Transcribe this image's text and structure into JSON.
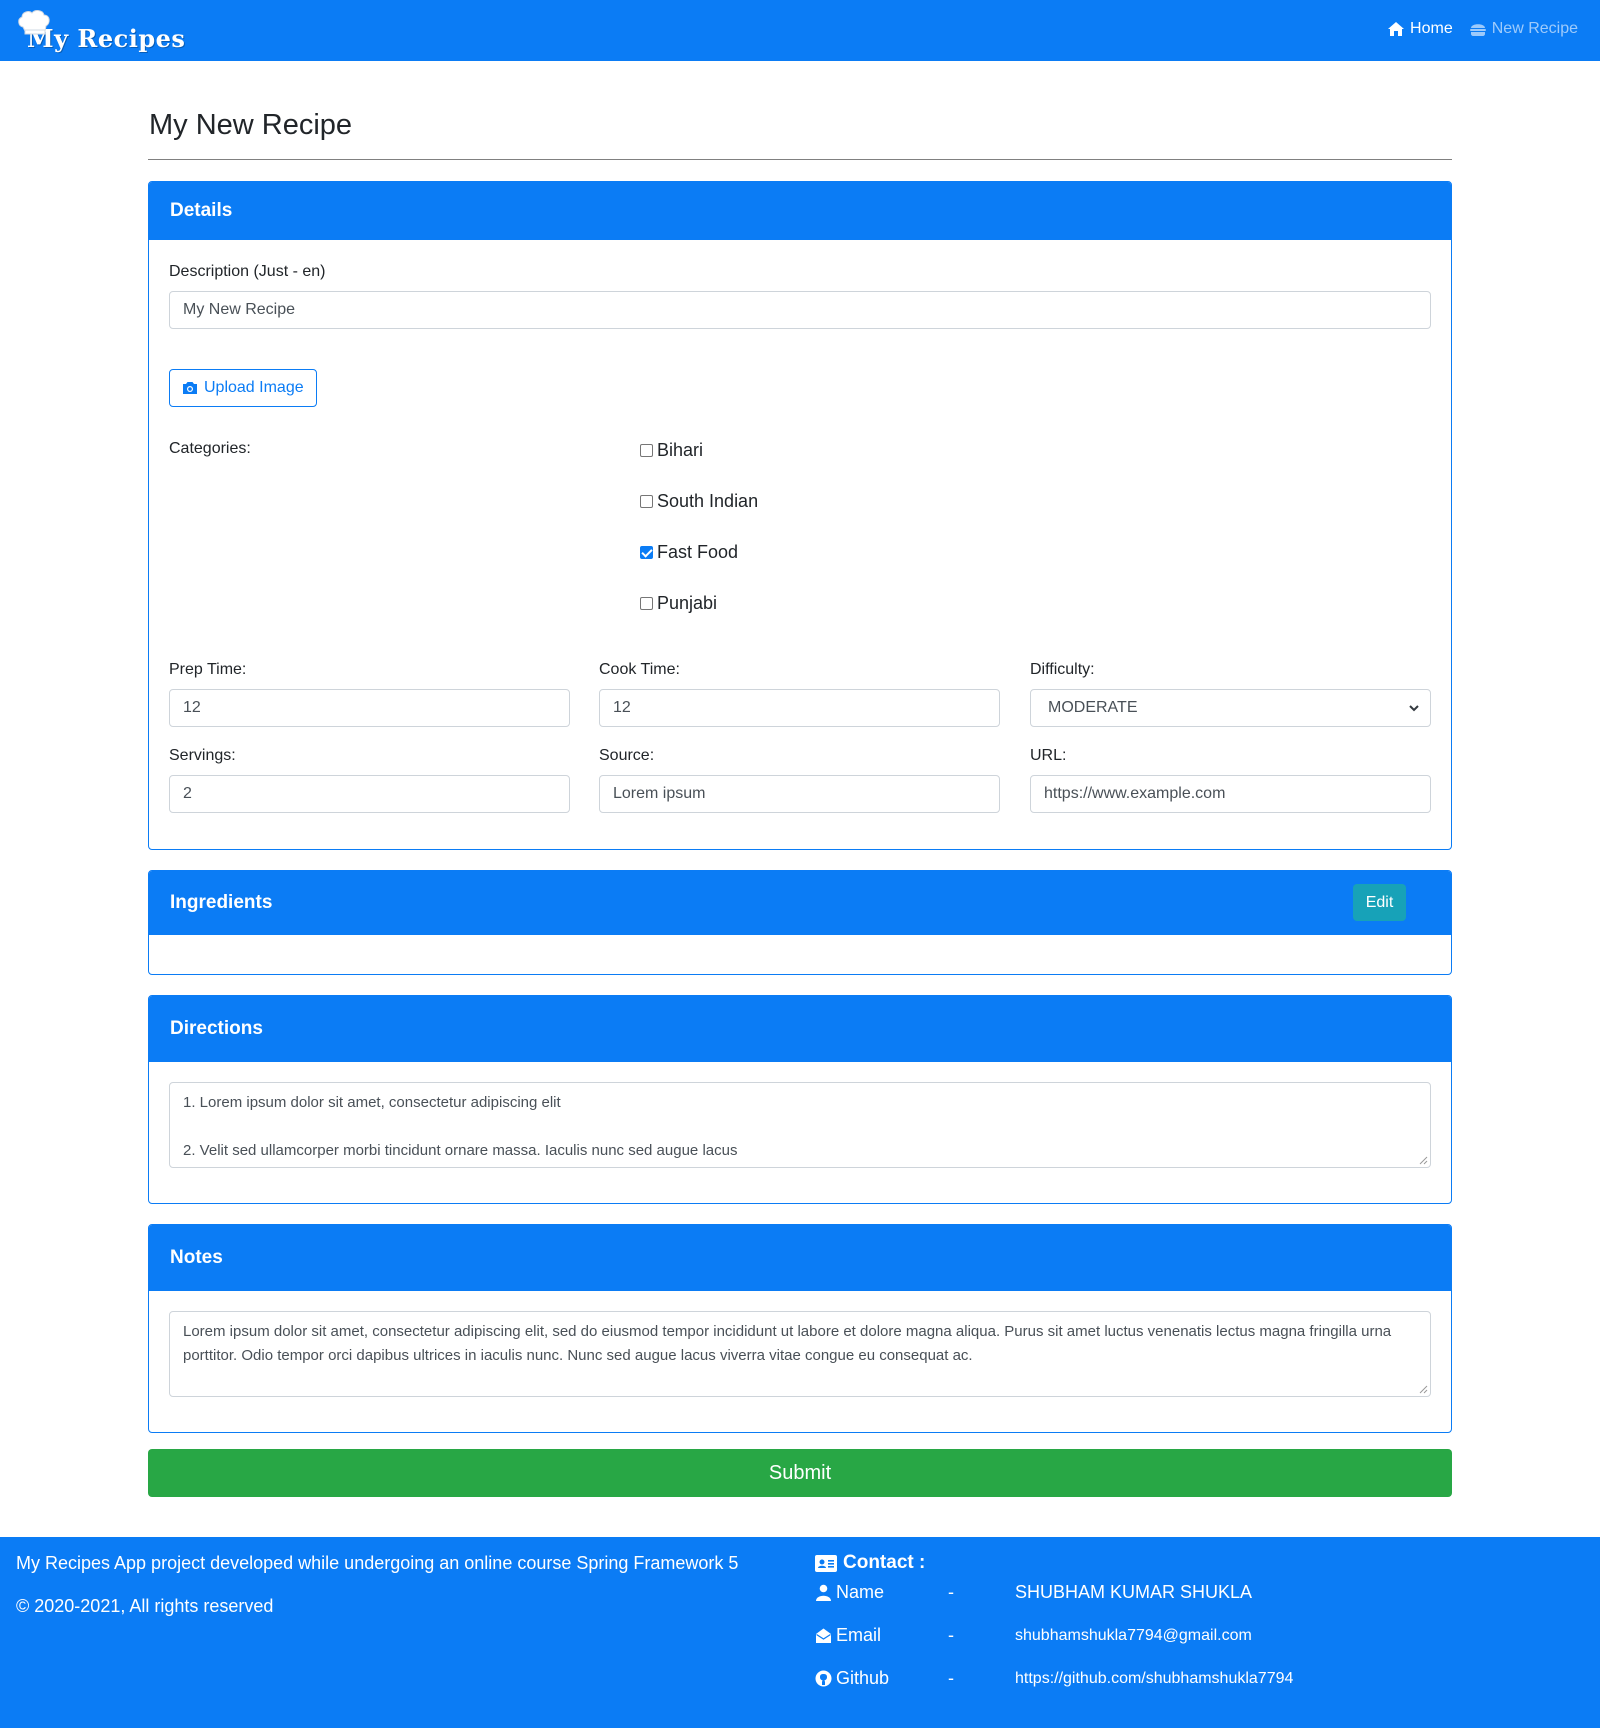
{
  "brand": {
    "name": "My Recipes"
  },
  "nav": {
    "home": "Home",
    "new_recipe": "New Recipe"
  },
  "page": {
    "title": "My New Recipe"
  },
  "details": {
    "header": "Details",
    "description_label": "Description (Just - en)",
    "description_value": "My New Recipe",
    "upload_label": "Upload Image",
    "categories_label": "Categories:",
    "categories": [
      {
        "label": "Bihari",
        "checked": false
      },
      {
        "label": "South Indian",
        "checked": false
      },
      {
        "label": "Fast Food",
        "checked": true
      },
      {
        "label": "Punjabi",
        "checked": false
      }
    ],
    "prep_time_label": "Prep Time:",
    "prep_time_value": "12",
    "cook_time_label": "Cook Time:",
    "cook_time_value": "12",
    "difficulty_label": "Difficulty:",
    "difficulty_value": "MODERATE",
    "servings_label": "Servings:",
    "servings_value": "2",
    "source_label": "Source:",
    "source_value": "Lorem ipsum",
    "url_label": "URL:",
    "url_value": "https://www.example.com"
  },
  "ingredients": {
    "header": "Ingredients",
    "edit_label": "Edit"
  },
  "directions": {
    "header": "Directions",
    "line1": "1. Lorem ipsum dolor sit amet, consectetur adipiscing elit",
    "line2": "2. Velit sed ullamcorper morbi tincidunt ornare massa. Iaculis nunc sed augue lacus"
  },
  "notes": {
    "header": "Notes",
    "text": "Lorem ipsum dolor sit amet, consectetur adipiscing elit, sed do eiusmod tempor incididunt ut labore et dolore magna aliqua. Purus sit amet luctus venenatis lectus magna fringilla urna porttitor. Odio tempor orci dapibus ultrices in iaculis nunc. Nunc sed augue lacus viverra vitae congue eu consequat ac."
  },
  "submit_label": "Submit",
  "footer": {
    "about": "My Recipes App project developed while undergoing an online course Spring Framework 5",
    "copyright": "© 2020-2021, All rights reserved",
    "contact_title": "Contact :",
    "name_label": "Name",
    "name_value": "SHUBHAM KUMAR SHUKLA",
    "email_label": "Email",
    "email_value": "shubhamshukla7794@gmail.com",
    "github_label": "Github",
    "github_value": "https://github.com/shubhamshukla7794",
    "dash": "-"
  },
  "colors": {
    "primary": "#0b7cf5",
    "success": "#28a745",
    "info": "#17a2b8"
  }
}
